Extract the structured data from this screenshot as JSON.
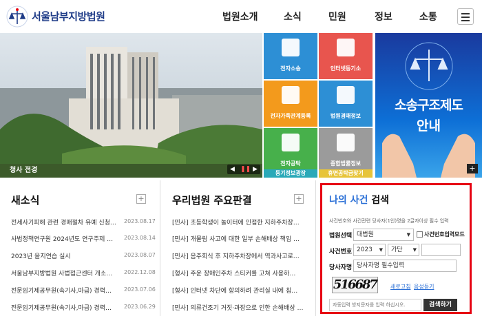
{
  "header": {
    "logo_text": "서울남부지방법원",
    "nav": [
      "법원소개",
      "소식",
      "민원",
      "정보",
      "소통"
    ]
  },
  "photo": {
    "caption": "청사 전경"
  },
  "tiles": [
    {
      "label": "전자소송",
      "color": "#2d8fd5"
    },
    {
      "label": "인터넷등기소",
      "color": "#e8554e"
    },
    {
      "label": "전자가족관계등록",
      "color": "#f39a1c"
    },
    {
      "label": "법원경매정보",
      "color": "#2d8fd5"
    },
    {
      "label": "전자공탁",
      "color": "#47b04b"
    },
    {
      "label": "종합법률정보",
      "color": "#9b9b9b"
    },
    {
      "label": "등기정보광장",
      "color": "#2aa9b8"
    },
    {
      "label": "휴면공탁금찾기",
      "color": "#e7c43a"
    }
  ],
  "banner": {
    "line1": "소송구조제도",
    "line2": "안내"
  },
  "news": {
    "title": "새소식",
    "items": [
      {
        "text": "전세사기피해 관련 경매절차 유예 신청…",
        "date": "2023.08.17"
      },
      {
        "text": "사법정책연구원 2024년도 연구주제 …",
        "date": "2023.08.14"
      },
      {
        "text": "2023년 을지연습 실시",
        "date": "2023.08.07"
      },
      {
        "text": "서울남부지방법원 사법접근센터 개소…",
        "date": "2022.12.08"
      },
      {
        "text": "전문임기제공무원(속기사,마급) 경력…",
        "date": "2023.07.06"
      },
      {
        "text": "전문임기제공무원(속기사,마급) 경력…",
        "date": "2023.06.29"
      }
    ]
  },
  "rulings": {
    "title": "우리법원 주요판결",
    "items": [
      "[민사] 초등학생이 놀이터에 인접한 지하주차장…",
      "[민사] 개물림 사고에 대한 일부 손해배상 책임 …",
      "[민사] 음주회식 후 지하주차장에서 역과사고로…",
      "[형사] 주운 장애인주차 스티커를 고쳐 사용하…",
      "[형사] 인터넷 차단에 항의하려 관리실 내에 침…",
      "[민사] 의류건조기 거짓·과장으로 인한 손해배상 …"
    ]
  },
  "case_search": {
    "title_highlight": "나의 사건",
    "title_rest": "검색",
    "notice": "사건번호와 사건관련 당사자(1인)명을 2글자이상 필수 입력",
    "court_label": "법원선택",
    "court_value": "대법원",
    "manual_label": "사건번호입력모드",
    "number_label": "사건번호",
    "year_value": "2023",
    "type_value": "가단",
    "party_label": "당사자명",
    "party_placeholder": "당사자명 필수입력",
    "captcha_text": "516687",
    "refresh_label": "새로고침",
    "audio_label": "음성듣기",
    "captcha_placeholder": "자동입력 방지문자를 입력 하십시오.",
    "search_button": "검색하기"
  },
  "colors": {
    "accent": "#e60012",
    "brand": "#1f3c88",
    "highlight": "#2a6fd6"
  }
}
